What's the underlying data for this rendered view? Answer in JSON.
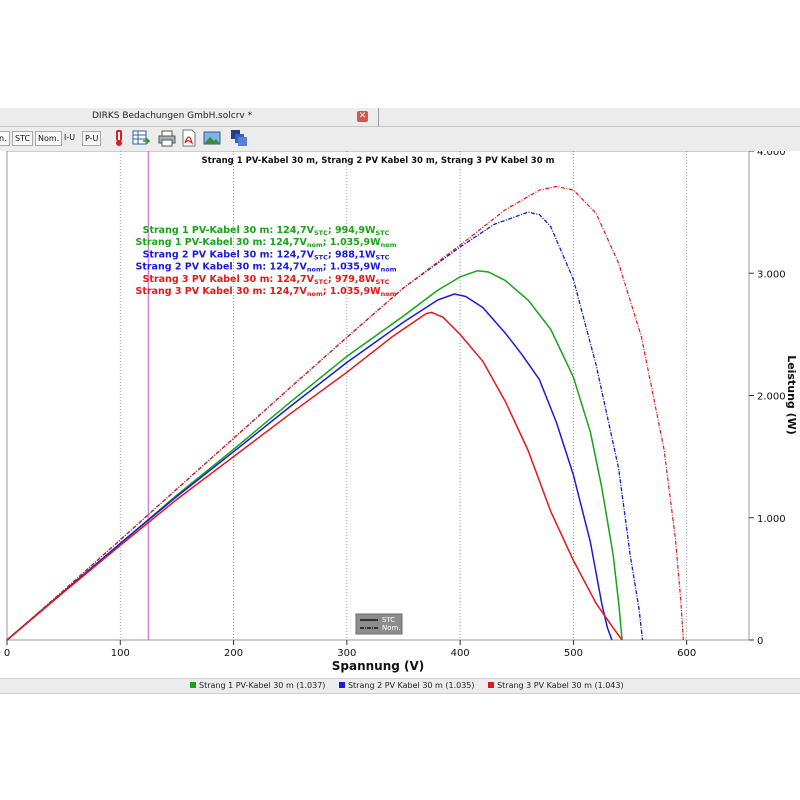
{
  "window": {
    "title": "DIRKS Bedachungen GmbH.solcrv *",
    "close_icon": "close-icon"
  },
  "toolbar": {
    "buttons": [
      "n.",
      "STC",
      "Nom.",
      "I-U",
      "P-U"
    ],
    "icons": [
      "thermometer-icon",
      "table-export-icon",
      "print-icon",
      "pdf-icon",
      "image-icon",
      "windows-icon"
    ]
  },
  "chart_data": {
    "type": "line",
    "title": "Strang 1 PV-Kabel 30 m, Strang 2 PV Kabel 30 m, Strang 3 PV Kabel 30 m",
    "xlabel": "Spannung (V)",
    "ylabel": "Leistung (W)",
    "xlim": [
      0,
      655
    ],
    "ylim": [
      0,
      4000
    ],
    "x_ticks": [
      "0",
      "100",
      "200",
      "300",
      "400",
      "500",
      "600"
    ],
    "y_ticks": [
      "0",
      "1.000",
      "2.000",
      "3.000",
      "4.000"
    ],
    "grid": true,
    "marker_voltage": 124.7,
    "colors": {
      "green": "#16a516",
      "blue": "#1a1ae0",
      "red": "#e51818",
      "marker": "#cc55cc"
    },
    "series": [
      {
        "name": "Strang 1 PV-Kabel 30 m",
        "condition": "STC",
        "color": "#16a516",
        "dash": false,
        "points": [
          [
            0,
            0
          ],
          [
            50,
            395
          ],
          [
            100,
            790
          ],
          [
            150,
            1185
          ],
          [
            200,
            1560
          ],
          [
            250,
            1945
          ],
          [
            300,
            2320
          ],
          [
            350,
            2650
          ],
          [
            380,
            2860
          ],
          [
            400,
            2970
          ],
          [
            415,
            3020
          ],
          [
            425,
            3010
          ],
          [
            440,
            2940
          ],
          [
            460,
            2780
          ],
          [
            480,
            2540
          ],
          [
            500,
            2150
          ],
          [
            515,
            1700
          ],
          [
            525,
            1250
          ],
          [
            535,
            700
          ],
          [
            540,
            300
          ],
          [
            542,
            100
          ],
          [
            543,
            0
          ]
        ]
      },
      {
        "name": "Strang 1 PV-Kabel 30 m",
        "condition": "Nom.",
        "color": "#16a516",
        "dash": true,
        "points": [
          [
            0,
            0
          ],
          [
            50,
            405
          ],
          [
            100,
            820
          ],
          [
            150,
            1235
          ],
          [
            200,
            1650
          ],
          [
            250,
            2065
          ],
          [
            300,
            2475
          ],
          [
            350,
            2880
          ],
          [
            400,
            3215
          ],
          [
            430,
            3400
          ],
          [
            460,
            3500
          ],
          [
            470,
            3480
          ],
          [
            480,
            3380
          ],
          [
            500,
            2950
          ],
          [
            520,
            2250
          ],
          [
            540,
            1400
          ],
          [
            550,
            700
          ],
          [
            558,
            250
          ],
          [
            561,
            0
          ]
        ]
      },
      {
        "name": "Strang 2 PV Kabel 30 m",
        "condition": "STC",
        "color": "#1a1ae0",
        "dash": false,
        "points": [
          [
            0,
            0
          ],
          [
            50,
            395
          ],
          [
            100,
            790
          ],
          [
            150,
            1175
          ],
          [
            200,
            1540
          ],
          [
            250,
            1910
          ],
          [
            300,
            2270
          ],
          [
            350,
            2600
          ],
          [
            380,
            2780
          ],
          [
            395,
            2830
          ],
          [
            405,
            2810
          ],
          [
            420,
            2720
          ],
          [
            440,
            2510
          ],
          [
            455,
            2330
          ],
          [
            470,
            2130
          ],
          [
            485,
            1780
          ],
          [
            500,
            1350
          ],
          [
            515,
            800
          ],
          [
            525,
            300
          ],
          [
            530,
            100
          ],
          [
            534,
            0
          ]
        ]
      },
      {
        "name": "Strang 2 PV Kabel 30 m",
        "condition": "Nom.",
        "color": "#1a1ae0",
        "dash": true,
        "points": [
          [
            0,
            0
          ],
          [
            50,
            405
          ],
          [
            100,
            820
          ],
          [
            150,
            1235
          ],
          [
            200,
            1650
          ],
          [
            250,
            2065
          ],
          [
            300,
            2475
          ],
          [
            350,
            2880
          ],
          [
            400,
            3215
          ],
          [
            430,
            3400
          ],
          [
            460,
            3500
          ],
          [
            470,
            3480
          ],
          [
            480,
            3380
          ],
          [
            500,
            2950
          ],
          [
            520,
            2250
          ],
          [
            540,
            1400
          ],
          [
            550,
            700
          ],
          [
            558,
            250
          ],
          [
            561,
            0
          ]
        ]
      },
      {
        "name": "Strang 3 PV Kabel 30 m",
        "condition": "STC",
        "color": "#e51818",
        "dash": false,
        "points": [
          [
            0,
            0
          ],
          [
            50,
            390
          ],
          [
            100,
            775
          ],
          [
            150,
            1150
          ],
          [
            200,
            1500
          ],
          [
            250,
            1850
          ],
          [
            300,
            2190
          ],
          [
            340,
            2480
          ],
          [
            370,
            2670
          ],
          [
            375,
            2680
          ],
          [
            385,
            2640
          ],
          [
            400,
            2500
          ],
          [
            420,
            2280
          ],
          [
            440,
            1950
          ],
          [
            460,
            1550
          ],
          [
            480,
            1050
          ],
          [
            500,
            650
          ],
          [
            520,
            300
          ],
          [
            535,
            100
          ],
          [
            543,
            0
          ]
        ]
      },
      {
        "name": "Strang 3 PV Kabel 30 m",
        "condition": "Nom.",
        "color": "#e51818",
        "dash": true,
        "points": [
          [
            0,
            0
          ],
          [
            50,
            405
          ],
          [
            100,
            820
          ],
          [
            150,
            1235
          ],
          [
            200,
            1650
          ],
          [
            250,
            2065
          ],
          [
            300,
            2475
          ],
          [
            350,
            2880
          ],
          [
            400,
            3230
          ],
          [
            440,
            3520
          ],
          [
            470,
            3680
          ],
          [
            485,
            3710
          ],
          [
            500,
            3680
          ],
          [
            520,
            3490
          ],
          [
            540,
            3080
          ],
          [
            560,
            2480
          ],
          [
            580,
            1560
          ],
          [
            590,
            830
          ],
          [
            595,
            300
          ],
          [
            597,
            0
          ]
        ]
      }
    ],
    "annotations": [
      {
        "color": "#16a516",
        "label": "Strang 1 PV-Kabel 30 m:",
        "voltage": "124,7V",
        "v_sub": "STC",
        "power": "994,9W",
        "p_sub": "STC"
      },
      {
        "color": "#16a516",
        "label": "Strang 1 PV-Kabel 30 m:",
        "voltage": "124,7V",
        "v_sub": "nom",
        "power": "1.035,9W",
        "p_sub": "nom"
      },
      {
        "color": "#1a1ae0",
        "label": "Strang 2 PV Kabel 30 m:",
        "voltage": "124,7V",
        "v_sub": "STC",
        "power": "988,1W",
        "p_sub": "STC"
      },
      {
        "color": "#1a1ae0",
        "label": "Strang 2 PV Kabel 30 m:",
        "voltage": "124,7V",
        "v_sub": "nom",
        "power": "1.035,9W",
        "p_sub": "nom"
      },
      {
        "color": "#e51818",
        "label": "Strang 3 PV Kabel 30 m:",
        "voltage": "124,7V",
        "v_sub": "STC",
        "power": "979,8W",
        "p_sub": "STC"
      },
      {
        "color": "#e51818",
        "label": "Strang 3 PV Kabel 30 m:",
        "voltage": "124,7V",
        "v_sub": "nom",
        "power": "1.035,9W",
        "p_sub": "nom"
      }
    ],
    "line_style_legend": [
      {
        "label": "STC",
        "dash": false
      },
      {
        "label": "Nom.",
        "dash": true
      }
    ],
    "legend": [
      {
        "label": "Strang 1 PV-Kabel 30 m (1.037)",
        "color": "#16a516"
      },
      {
        "label": "Strang 2 PV Kabel 30 m (1.035)",
        "color": "#1a1ae0"
      },
      {
        "label": "Strang 3 PV Kabel 30 m (1.043)",
        "color": "#e51818"
      }
    ]
  }
}
